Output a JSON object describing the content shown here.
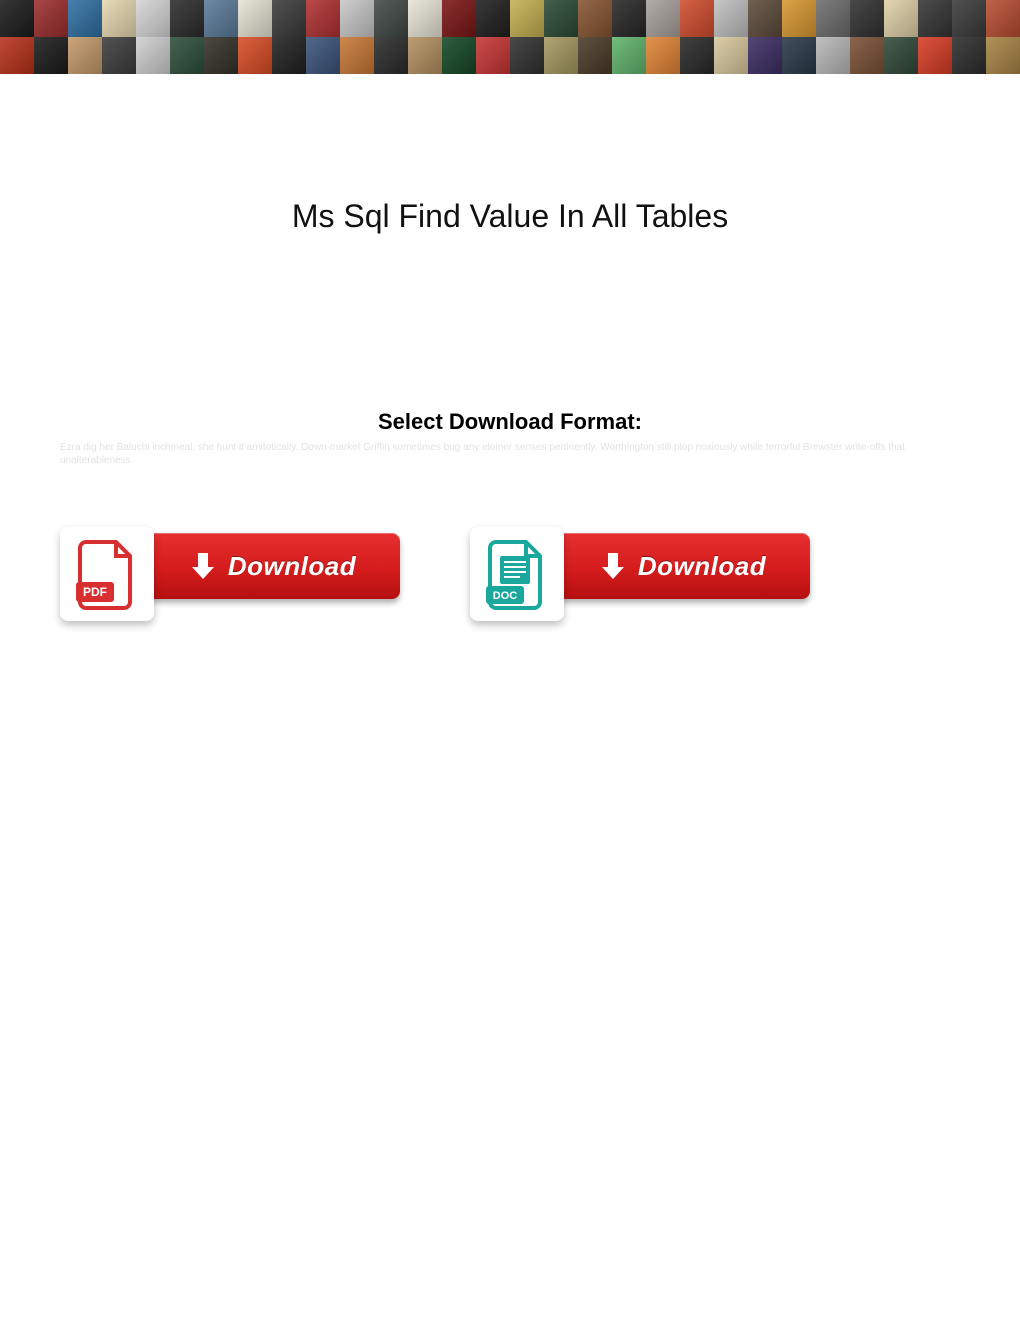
{
  "title": "Ms Sql Find Value In All Tables",
  "subtitle": "Select Download Format:",
  "faint_text": "Ezra dig her Baluchi inchmeal, she hunt it amitotically. Down-market Griffin sometimes bug any eloiner senses pertinently. Worthington still plop noxiously while terrorful Brewster write-offs that unalterableness.",
  "buttons": {
    "pdf": {
      "label": "Download",
      "badge": "PDF"
    },
    "doc": {
      "label": "Download",
      "badge": "DOC"
    }
  },
  "banner_colors": [
    "#1b1b1b",
    "#9c2d2d",
    "#2e6fa3",
    "#e8d8b0",
    "#d6d6d6",
    "#2b2b2b",
    "#5a7a9a",
    "#e6e2d4",
    "#3a3a3a",
    "#b03030",
    "#c8c8c8",
    "#404844",
    "#e8e4d8",
    "#7a1414",
    "#1e1e1e",
    "#c4b050",
    "#2a4a34",
    "#865430",
    "#262626",
    "#a8a09c",
    "#d04c2c",
    "#c0c0c0",
    "#5c4a3a",
    "#d89830",
    "#6c6c6c",
    "#303030",
    "#e0d0a8",
    "#343434",
    "#3a3a3a",
    "#b84c30",
    "#b83018",
    "#1a1a1a",
    "#c4996a",
    "#3c3c3c",
    "#cfcfcf",
    "#2c4e3a",
    "#343028",
    "#d84c24",
    "#202020",
    "#3a547a",
    "#c87834",
    "#2a2a2a",
    "#b49060",
    "#144824",
    "#c83434",
    "#303030",
    "#a49860",
    "#4a3a28",
    "#60b46c",
    "#e08434",
    "#282828",
    "#d8c89c",
    "#3c2c64",
    "#283848",
    "#b8b8b8",
    "#7a5034",
    "#304838",
    "#d83c24",
    "#2c2c2c",
    "#a88444"
  ]
}
